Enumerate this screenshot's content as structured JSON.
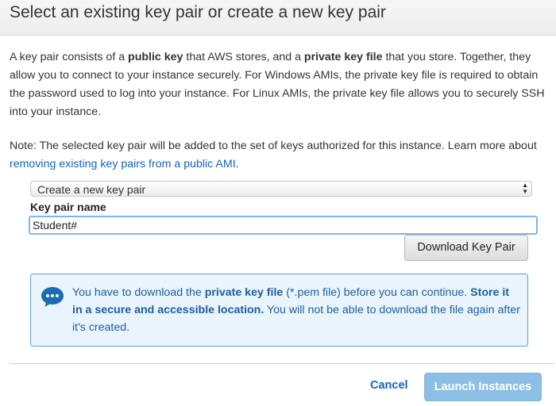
{
  "dialog": {
    "title": "Select an existing key pair or create a new key pair"
  },
  "intro": {
    "p1": "A key pair consists of a ",
    "b1": "public key",
    "p2": " that AWS stores, and a ",
    "b2": "private key file",
    "p3": " that you store. Together, they allow you to connect to your instance securely. For Windows AMIs, the private key file is required to obtain the password used to log into your instance. For Linux AMIs, the private key file allows you to securely SSH into your instance."
  },
  "note": {
    "text": "Note: The selected key pair will be added to the set of keys authorized for this instance. Learn more about ",
    "link": "removing existing key pairs from a public AMI",
    "end": "."
  },
  "keypair_select": {
    "selected": "Create a new key pair"
  },
  "keypair_name": {
    "label": "Key pair name",
    "value": "Student#"
  },
  "download_button": "Download Key Pair",
  "alert": {
    "p1": "You have to download the ",
    "b1": "private key file",
    "p2": " (*.pem file) before you can continue. ",
    "b2": "Store it in a secure and accessible location.",
    "p3": " You will not be able to download the file again after it's created.",
    "icon": "chat-bubble-icon",
    "color": "#1a5f9e"
  },
  "footer": {
    "cancel": "Cancel",
    "launch": "Launch Instances"
  },
  "colors": {
    "link": "#1166bb",
    "launch_button": "#8cbfe5",
    "alert_border": "#5aa0d8",
    "alert_bg": "#eaf4fd"
  }
}
